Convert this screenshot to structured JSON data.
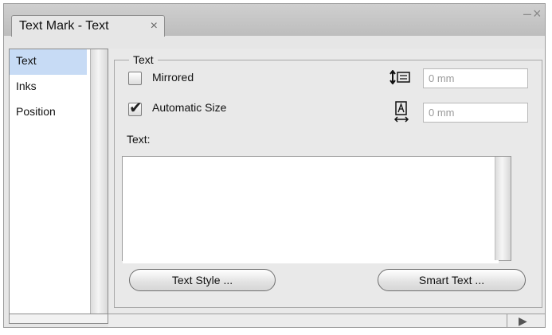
{
  "window": {
    "tab_title": "Text Mark - Text",
    "close_glyph": "×",
    "minimize_glyph": "–",
    "window_close_glyph": "×"
  },
  "sidebar": {
    "items": [
      {
        "label": "Text",
        "selected": true
      },
      {
        "label": "Inks",
        "selected": false
      },
      {
        "label": "Position",
        "selected": false
      }
    ]
  },
  "group": {
    "label": "Text",
    "mirrored": {
      "label": "Mirrored",
      "checked": false
    },
    "automatic_size": {
      "label": "Automatic Size",
      "checked": true
    },
    "height_field": {
      "value": "0 mm",
      "icon": "height-dimension-icon"
    },
    "width_field": {
      "value": "0 mm",
      "icon": "width-dimension-icon"
    },
    "text_label": "Text:",
    "text_value": ""
  },
  "buttons": {
    "text_style": "Text Style ...",
    "smart_text": "Smart Text ..."
  },
  "footer": {
    "play_glyph": "▶"
  }
}
